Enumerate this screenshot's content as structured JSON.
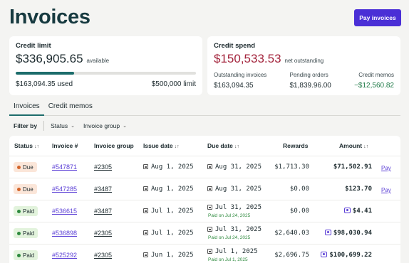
{
  "page": {
    "title": "Invoices",
    "pay_button": "Pay invoices"
  },
  "credit_limit": {
    "label": "Credit limit",
    "available_amount": "$336,905.65",
    "available_suffix": "available",
    "used": "$163,094.35 used",
    "limit": "$500,000 limit",
    "used_fraction": 0.326
  },
  "credit_spend": {
    "label": "Credit spend",
    "net_amount": "$150,533.53",
    "net_suffix": "net outstanding",
    "stats": [
      {
        "label": "Outstanding invoices",
        "value": "$163,094.35"
      },
      {
        "label": "Pending orders",
        "value": "$1,839.96.00"
      },
      {
        "label": "Credit memos",
        "value": "−$12,560.82"
      }
    ]
  },
  "tabs": [
    "Invoices",
    "Credit memos"
  ],
  "filters": {
    "label": "Filter by",
    "status": "Status",
    "invoice_group": "Invoice group"
  },
  "columns": {
    "status": "Status",
    "invoice": "Invoice #",
    "group": "Invoice group",
    "issue": "Issue date",
    "due": "Due date",
    "rewards": "Rewards",
    "amount": "Amount"
  },
  "rows": [
    {
      "status": "Due",
      "invoice": "#547871",
      "group": "#2305",
      "issue": "Aug 1, 2025",
      "due": "Aug 31, 2025",
      "paid_on": "",
      "rewards": "$1,713.30",
      "amount": "$71,502.91",
      "action": "Pay"
    },
    {
      "status": "Due",
      "invoice": "#547285",
      "group": "#3487",
      "issue": "Aug 1, 2025",
      "due": "Aug 31, 2025",
      "paid_on": "",
      "rewards": "$0.00",
      "amount": "$123.70",
      "action": "Pay"
    },
    {
      "status": "Paid",
      "invoice": "#536615",
      "group": "#3487",
      "issue": "Jul 1, 2025",
      "due": "Jul 31, 2025",
      "paid_on": "Paid on Jul 24, 2025",
      "rewards": "$0.00",
      "amount": "$4.41",
      "action": ""
    },
    {
      "status": "Paid",
      "invoice": "#536898",
      "group": "#2305",
      "issue": "Jul 1, 2025",
      "due": "Jul 31, 2025",
      "paid_on": "Paid on Jul 24, 2025",
      "rewards": "$2,640.03",
      "amount": "$98,030.94",
      "action": ""
    },
    {
      "status": "Paid",
      "invoice": "#525292",
      "group": "#2305",
      "issue": "Jun 1, 2025",
      "due": "Jul 1, 2025",
      "paid_on": "Paid on Jul 1, 2025",
      "rewards": "$2,696.75",
      "amount": "$100,699.22",
      "action": ""
    }
  ],
  "colors": {
    "accent": "#4a2fd6",
    "teal": "#1c6c6b",
    "spend_red": "#a3243c",
    "due": "#d4652b",
    "paid": "#2e8a3e"
  },
  "icons": {
    "calendar": "calendar-icon",
    "rewards": "rewards-card-icon",
    "sort": "sort-arrows-icon",
    "chevron": "chevron-down-icon"
  }
}
